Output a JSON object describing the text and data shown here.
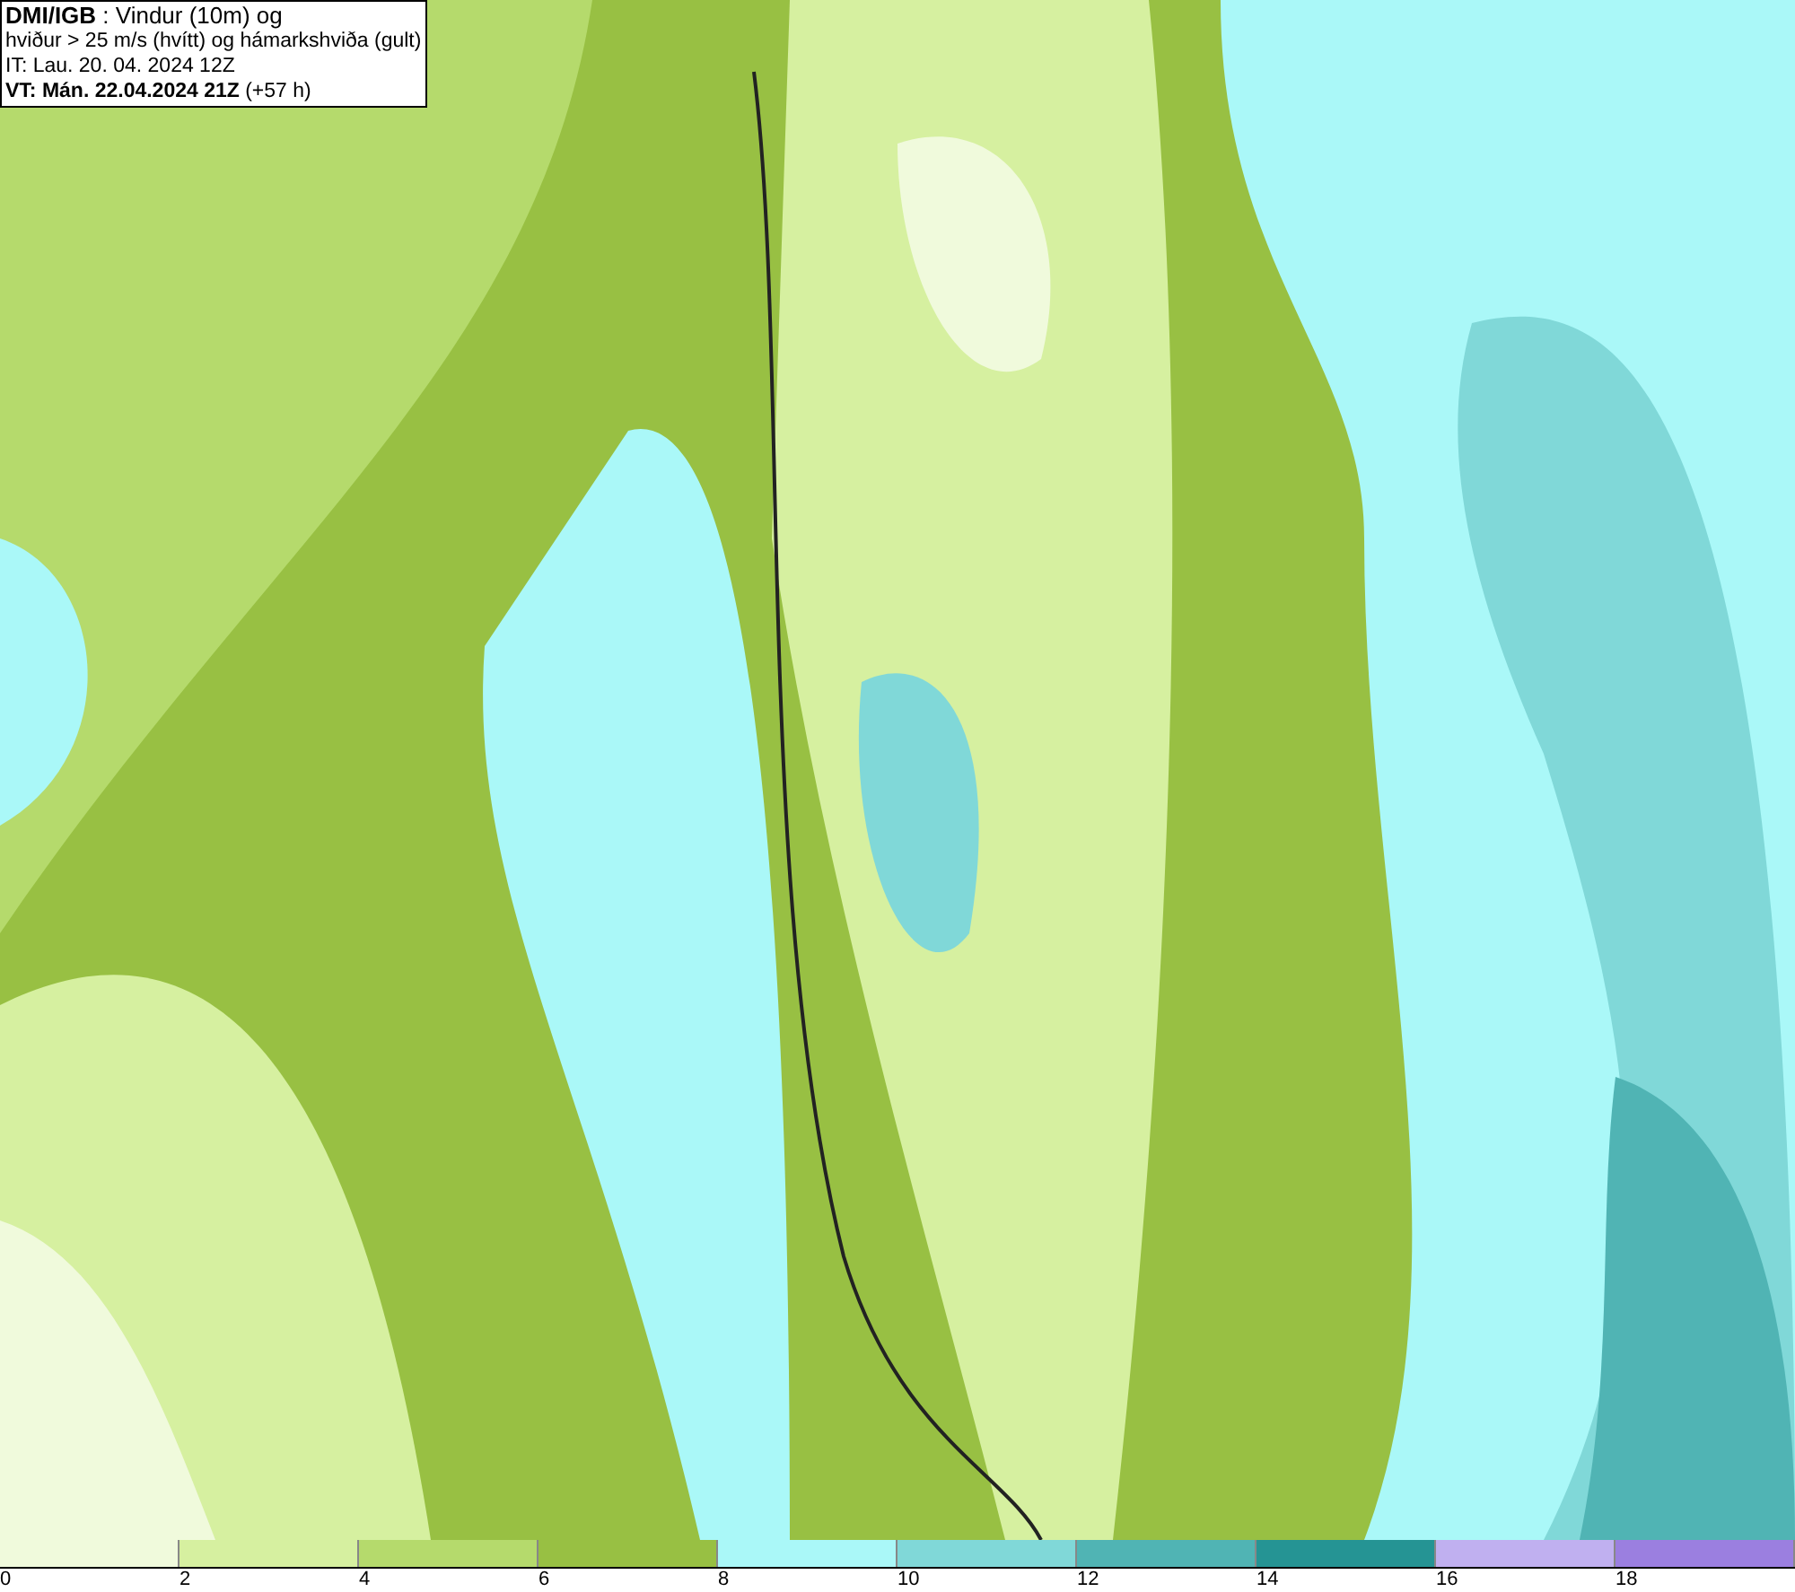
{
  "title_box": {
    "lines": [
      "**DMI/IGB** : Vindur (10m) og",
      "hviður > 25 m/s (hvítt) og hámarkshviða (gult)",
      "IT: Lau. 20. 04. 2024 12Z",
      "**VT: Mán. 22.04.2024 21Z** (+57 h)"
    ]
  },
  "legend": {
    "segments": [
      {
        "color": "#f0fadc"
      },
      {
        "color": "#d6f0a0"
      },
      {
        "color": "#b5da6c"
      },
      {
        "color": "#98c043"
      },
      {
        "color": "#aaf8f8"
      },
      {
        "color": "#80d8d8"
      },
      {
        "color": "#50b4b4"
      },
      {
        "color": "#259494"
      },
      {
        "color": "#c0b0f0"
      },
      {
        "color": "#9b7fe0"
      }
    ],
    "ticks": [
      "0",
      "2",
      "4",
      "6",
      "8",
      "10",
      "12",
      "14",
      "16",
      "18"
    ]
  }
}
